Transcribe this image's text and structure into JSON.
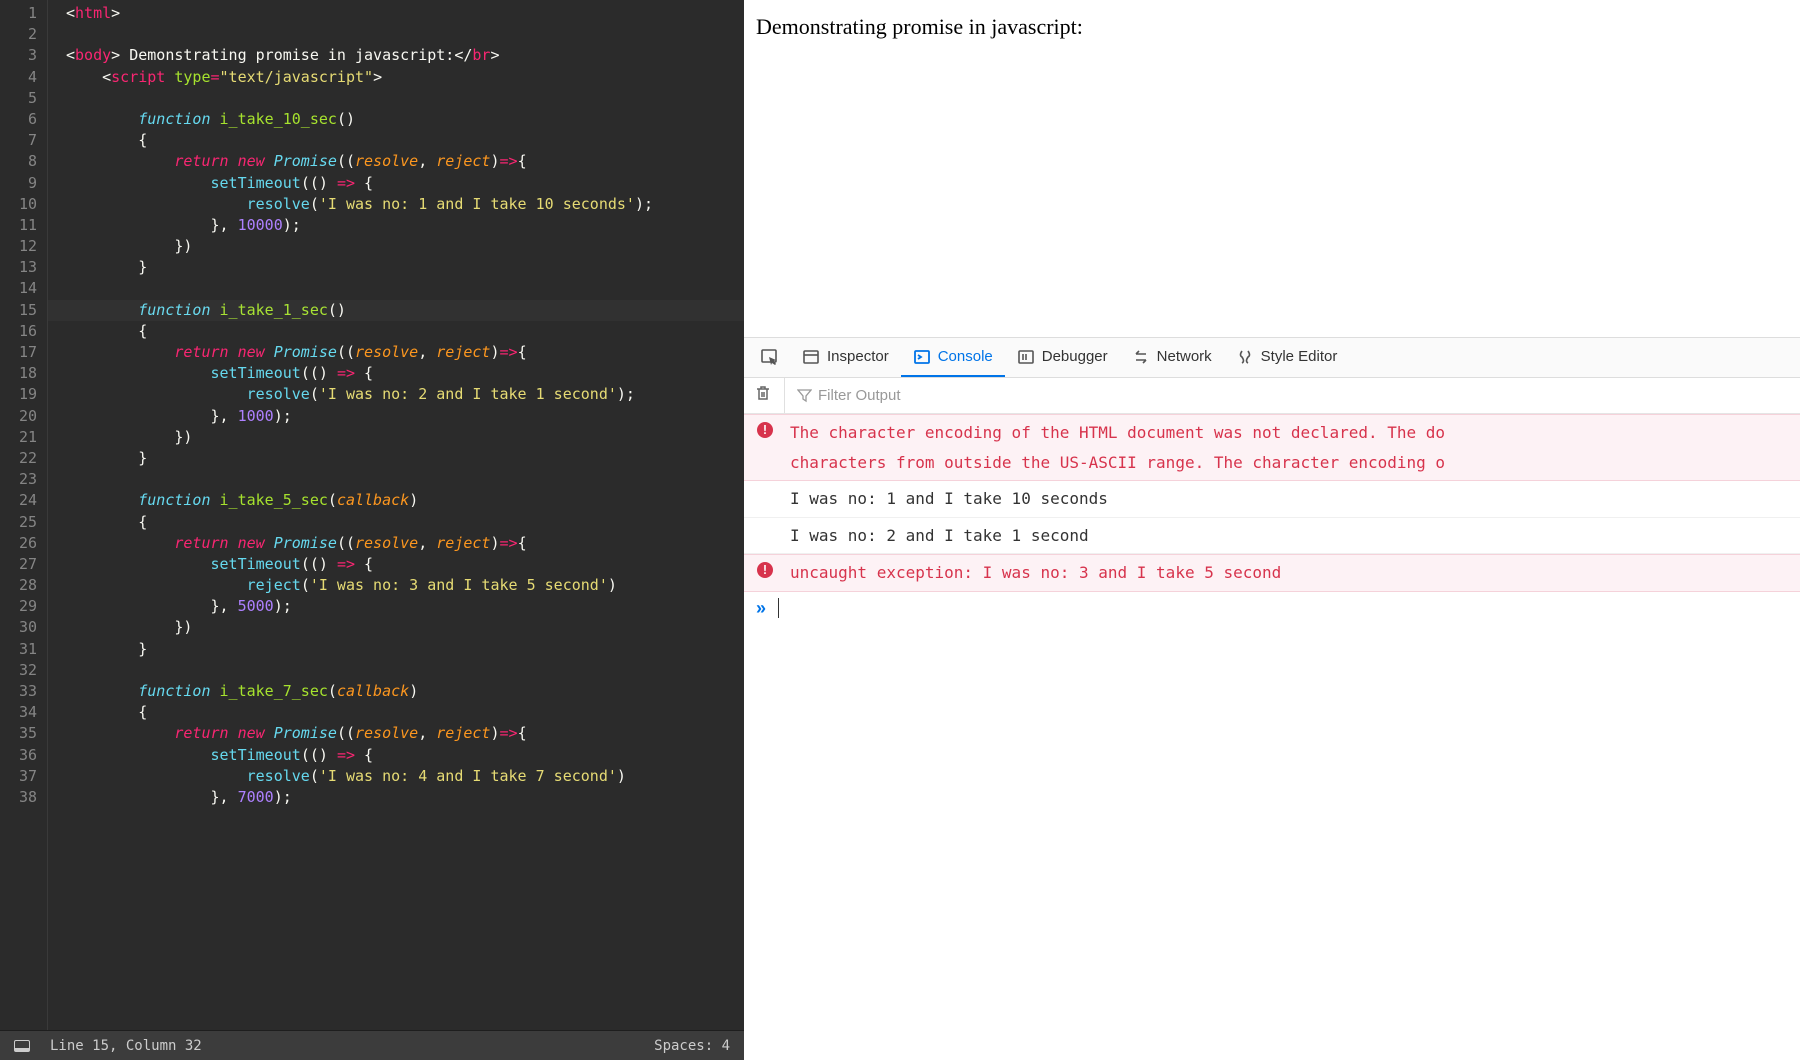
{
  "editor": {
    "line_count": 38,
    "highlighted_line": 15,
    "code_lines": [
      {
        "n": 1,
        "tokens": [
          [
            "<",
            "t-angle"
          ],
          [
            "html",
            "t-tag"
          ],
          [
            ">",
            "t-angle"
          ]
        ]
      },
      {
        "n": 2,
        "tokens": []
      },
      {
        "n": 3,
        "tokens": [
          [
            "<",
            "t-angle"
          ],
          [
            "body",
            "t-tag"
          ],
          [
            ">",
            "t-angle"
          ],
          [
            " Demonstrating promise in javascript:",
            "t-txt"
          ],
          [
            "</",
            "t-angle"
          ],
          [
            "br",
            "t-tag"
          ],
          [
            ">",
            "t-angle"
          ]
        ]
      },
      {
        "n": 4,
        "tokens": [
          [
            "    ",
            "t-txt"
          ],
          [
            "<",
            "t-angle"
          ],
          [
            "script",
            "t-tag"
          ],
          [
            " ",
            "t-txt"
          ],
          [
            "type",
            "t-attr"
          ],
          [
            "=",
            "t-op"
          ],
          [
            "\"text/javascript\"",
            "t-str"
          ],
          [
            ">",
            "t-angle"
          ]
        ]
      },
      {
        "n": 5,
        "tokens": []
      },
      {
        "n": 6,
        "tokens": [
          [
            "        ",
            "t-txt"
          ],
          [
            "function",
            "t-kw2"
          ],
          [
            " ",
            "t-txt"
          ],
          [
            "i_take_10_sec",
            "t-fn"
          ],
          [
            "()",
            "t-pun"
          ]
        ]
      },
      {
        "n": 7,
        "tokens": [
          [
            "        {",
            "t-pun"
          ]
        ]
      },
      {
        "n": 8,
        "tokens": [
          [
            "            ",
            "t-txt"
          ],
          [
            "return",
            "t-kw"
          ],
          [
            " ",
            "t-txt"
          ],
          [
            "new",
            "t-kw"
          ],
          [
            " ",
            "t-txt"
          ],
          [
            "Promise",
            "t-kw2"
          ],
          [
            "((",
            "t-pun"
          ],
          [
            "resolve",
            "t-param"
          ],
          [
            ", ",
            "t-pun"
          ],
          [
            "reject",
            "t-param"
          ],
          [
            ")",
            "t-pun"
          ],
          [
            "=>",
            "t-op"
          ],
          [
            "{",
            "t-pun"
          ]
        ]
      },
      {
        "n": 9,
        "tokens": [
          [
            "                ",
            "t-txt"
          ],
          [
            "setTimeout",
            "t-fncall"
          ],
          [
            "(() ",
            "t-pun"
          ],
          [
            "=>",
            "t-op"
          ],
          [
            " {",
            "t-pun"
          ]
        ]
      },
      {
        "n": 10,
        "tokens": [
          [
            "                    ",
            "t-txt"
          ],
          [
            "resolve",
            "t-fncall"
          ],
          [
            "(",
            "t-pun"
          ],
          [
            "'I was no: 1 and I take 10 seconds'",
            "t-str"
          ],
          [
            ");",
            "t-pun"
          ]
        ]
      },
      {
        "n": 11,
        "tokens": [
          [
            "                }, ",
            "t-pun"
          ],
          [
            "10000",
            "t-num"
          ],
          [
            ");",
            "t-pun"
          ]
        ]
      },
      {
        "n": 12,
        "tokens": [
          [
            "            })",
            "t-pun"
          ]
        ]
      },
      {
        "n": 13,
        "tokens": [
          [
            "        }",
            "t-pun"
          ]
        ]
      },
      {
        "n": 14,
        "tokens": []
      },
      {
        "n": 15,
        "tokens": [
          [
            "        ",
            "t-txt"
          ],
          [
            "function",
            "t-kw2"
          ],
          [
            " ",
            "t-txt"
          ],
          [
            "i_take_1_sec",
            "t-fn"
          ],
          [
            "()",
            "t-pun"
          ]
        ]
      },
      {
        "n": 16,
        "tokens": [
          [
            "        {",
            "t-pun"
          ]
        ]
      },
      {
        "n": 17,
        "tokens": [
          [
            "            ",
            "t-txt"
          ],
          [
            "return",
            "t-kw"
          ],
          [
            " ",
            "t-txt"
          ],
          [
            "new",
            "t-kw"
          ],
          [
            " ",
            "t-txt"
          ],
          [
            "Promise",
            "t-kw2"
          ],
          [
            "((",
            "t-pun"
          ],
          [
            "resolve",
            "t-param"
          ],
          [
            ", ",
            "t-pun"
          ],
          [
            "reject",
            "t-param"
          ],
          [
            ")",
            "t-pun"
          ],
          [
            "=>",
            "t-op"
          ],
          [
            "{",
            "t-pun"
          ]
        ]
      },
      {
        "n": 18,
        "tokens": [
          [
            "                ",
            "t-txt"
          ],
          [
            "setTimeout",
            "t-fncall"
          ],
          [
            "(() ",
            "t-pun"
          ],
          [
            "=>",
            "t-op"
          ],
          [
            " {",
            "t-pun"
          ]
        ]
      },
      {
        "n": 19,
        "tokens": [
          [
            "                    ",
            "t-txt"
          ],
          [
            "resolve",
            "t-fncall"
          ],
          [
            "(",
            "t-pun"
          ],
          [
            "'I was no: 2 and I take 1 second'",
            "t-str"
          ],
          [
            ");",
            "t-pun"
          ]
        ]
      },
      {
        "n": 20,
        "tokens": [
          [
            "                }, ",
            "t-pun"
          ],
          [
            "1000",
            "t-num"
          ],
          [
            ");",
            "t-pun"
          ]
        ]
      },
      {
        "n": 21,
        "tokens": [
          [
            "            })",
            "t-pun"
          ]
        ]
      },
      {
        "n": 22,
        "tokens": [
          [
            "        }",
            "t-pun"
          ]
        ]
      },
      {
        "n": 23,
        "tokens": []
      },
      {
        "n": 24,
        "tokens": [
          [
            "        ",
            "t-txt"
          ],
          [
            "function",
            "t-kw2"
          ],
          [
            " ",
            "t-txt"
          ],
          [
            "i_take_5_sec",
            "t-fn"
          ],
          [
            "(",
            "t-pun"
          ],
          [
            "callback",
            "t-param"
          ],
          [
            ")",
            "t-pun"
          ]
        ]
      },
      {
        "n": 25,
        "tokens": [
          [
            "        {",
            "t-pun"
          ]
        ]
      },
      {
        "n": 26,
        "tokens": [
          [
            "            ",
            "t-txt"
          ],
          [
            "return",
            "t-kw"
          ],
          [
            " ",
            "t-txt"
          ],
          [
            "new",
            "t-kw"
          ],
          [
            " ",
            "t-txt"
          ],
          [
            "Promise",
            "t-kw2"
          ],
          [
            "((",
            "t-pun"
          ],
          [
            "resolve",
            "t-param"
          ],
          [
            ", ",
            "t-pun"
          ],
          [
            "reject",
            "t-param"
          ],
          [
            ")",
            "t-pun"
          ],
          [
            "=>",
            "t-op"
          ],
          [
            "{",
            "t-pun"
          ]
        ]
      },
      {
        "n": 27,
        "tokens": [
          [
            "                ",
            "t-txt"
          ],
          [
            "setTimeout",
            "t-fncall"
          ],
          [
            "(() ",
            "t-pun"
          ],
          [
            "=>",
            "t-op"
          ],
          [
            " {",
            "t-pun"
          ]
        ]
      },
      {
        "n": 28,
        "tokens": [
          [
            "                    ",
            "t-txt"
          ],
          [
            "reject",
            "t-fncall"
          ],
          [
            "(",
            "t-pun"
          ],
          [
            "'I was no: 3 and I take 5 second'",
            "t-str"
          ],
          [
            ")",
            "t-pun"
          ]
        ]
      },
      {
        "n": 29,
        "tokens": [
          [
            "                }, ",
            "t-pun"
          ],
          [
            "5000",
            "t-num"
          ],
          [
            ");",
            "t-pun"
          ]
        ]
      },
      {
        "n": 30,
        "tokens": [
          [
            "            })",
            "t-pun"
          ]
        ]
      },
      {
        "n": 31,
        "tokens": [
          [
            "        }",
            "t-pun"
          ]
        ]
      },
      {
        "n": 32,
        "tokens": []
      },
      {
        "n": 33,
        "tokens": [
          [
            "        ",
            "t-txt"
          ],
          [
            "function",
            "t-kw2"
          ],
          [
            " ",
            "t-txt"
          ],
          [
            "i_take_7_sec",
            "t-fn"
          ],
          [
            "(",
            "t-pun"
          ],
          [
            "callback",
            "t-param"
          ],
          [
            ")",
            "t-pun"
          ]
        ]
      },
      {
        "n": 34,
        "tokens": [
          [
            "        {",
            "t-pun"
          ]
        ]
      },
      {
        "n": 35,
        "tokens": [
          [
            "            ",
            "t-txt"
          ],
          [
            "return",
            "t-kw"
          ],
          [
            " ",
            "t-txt"
          ],
          [
            "new",
            "t-kw"
          ],
          [
            " ",
            "t-txt"
          ],
          [
            "Promise",
            "t-kw2"
          ],
          [
            "((",
            "t-pun"
          ],
          [
            "resolve",
            "t-param"
          ],
          [
            ", ",
            "t-pun"
          ],
          [
            "reject",
            "t-param"
          ],
          [
            ")",
            "t-pun"
          ],
          [
            "=>",
            "t-op"
          ],
          [
            "{",
            "t-pun"
          ]
        ]
      },
      {
        "n": 36,
        "tokens": [
          [
            "                ",
            "t-txt"
          ],
          [
            "setTimeout",
            "t-fncall"
          ],
          [
            "(() ",
            "t-pun"
          ],
          [
            "=>",
            "t-op"
          ],
          [
            " {",
            "t-pun"
          ]
        ]
      },
      {
        "n": 37,
        "tokens": [
          [
            "                    ",
            "t-txt"
          ],
          [
            "resolve",
            "t-fncall"
          ],
          [
            "(",
            "t-pun"
          ],
          [
            "'I was no: 4 and I take 7 second'",
            "t-str"
          ],
          [
            ")",
            "t-pun"
          ]
        ]
      },
      {
        "n": 38,
        "tokens": [
          [
            "                }, ",
            "t-pun"
          ],
          [
            "7000",
            "t-num"
          ],
          [
            ");",
            "t-pun"
          ]
        ]
      }
    ]
  },
  "status": {
    "position": "Line 15, Column 32",
    "spaces": "Spaces: 4"
  },
  "preview": {
    "text": "Demonstrating promise in javascript:"
  },
  "devtools": {
    "tabs": {
      "inspector": "Inspector",
      "console": "Console",
      "debugger": "Debugger",
      "network": "Network",
      "style": "Style Editor"
    },
    "active_tab": "console",
    "filter_placeholder": "Filter Output"
  },
  "console_entries": [
    {
      "type": "err",
      "text": "The character encoding of the HTML document was not declared. The do\ncharacters from outside the US-ASCII range. The character encoding o"
    },
    {
      "type": "log",
      "text": "I was no: 1 and I take 10 seconds"
    },
    {
      "type": "log",
      "text": "I was no: 2 and I take 1 second"
    },
    {
      "type": "err",
      "text": "uncaught exception: I was no: 3 and I take 5 second"
    }
  ]
}
